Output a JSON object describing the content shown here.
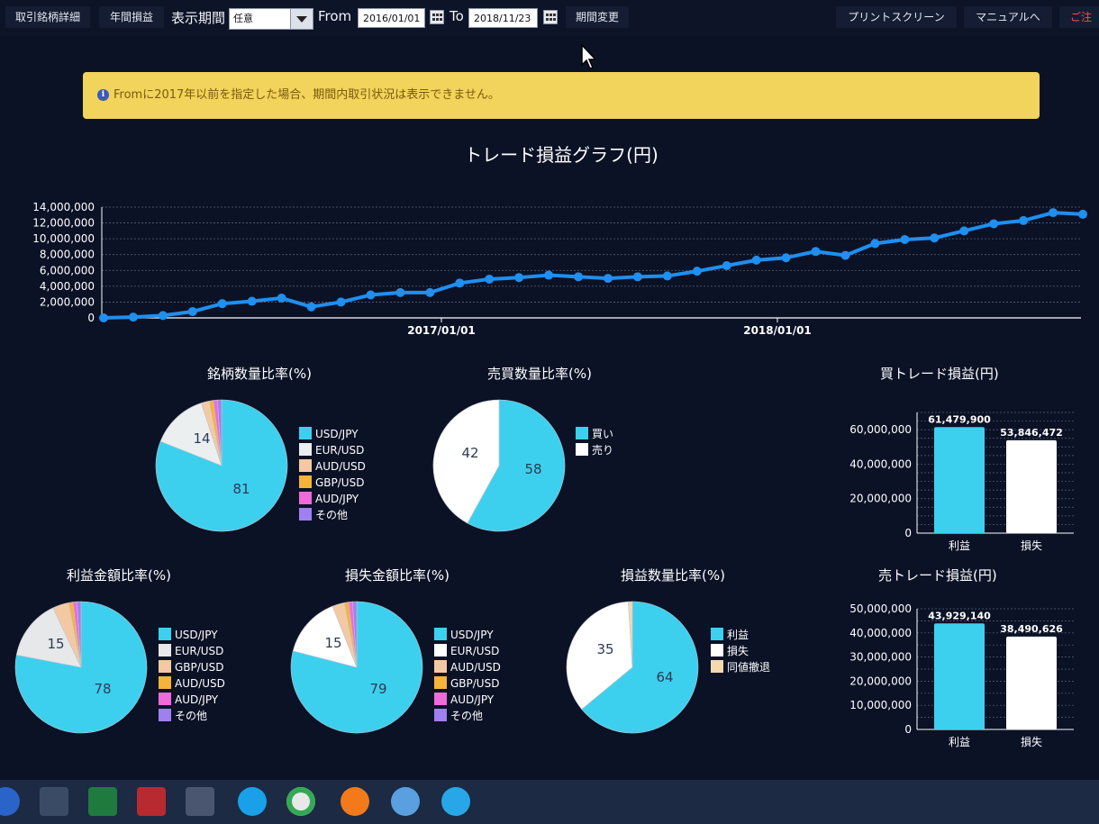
{
  "toolbar": {
    "btn_detail": "取引銘柄詳細",
    "btn_yearly": "年間損益",
    "period_label": "表示期間",
    "period_value": "任意",
    "from_label": "From",
    "from_value": "2016/01/01",
    "to_label": "To",
    "to_value": "2018/11/23",
    "btn_change": "期間変更",
    "btn_print": "プリントスクリーン",
    "btn_manual": "マニュアルへ",
    "btn_extra": "ご注"
  },
  "banner": {
    "text": "Fromに2017年以前を指定した場合、期間内取引状況は表示できません。"
  },
  "colors": {
    "accent": "#1f8ff0",
    "cyan": "#3dd0ee",
    "white": "#ffffff",
    "banner": "#f2d35b"
  },
  "chart_data": [
    {
      "type": "line",
      "title": "トレード損益グラフ(円)",
      "x_ticks": [
        "2017/01/01",
        "2018/01/01"
      ],
      "y_ticks": [
        "0",
        "2,000,000",
        "4,000,000",
        "6,000,000",
        "8,000,000",
        "10,000,000",
        "12,000,000",
        "14,000,000"
      ],
      "ylim": [
        0,
        14000000
      ],
      "values": [
        0,
        100000,
        300000,
        800000,
        1800000,
        2100000,
        2500000,
        1400000,
        2000000,
        2900000,
        3200000,
        3200000,
        4400000,
        4900000,
        5100000,
        5400000,
        5200000,
        5000000,
        5200000,
        5300000,
        5900000,
        6600000,
        7300000,
        7600000,
        8400000,
        7900000,
        9400000,
        9900000,
        10100000,
        11000000,
        11900000,
        12300000,
        13300000,
        13100000
      ]
    },
    {
      "type": "pie",
      "title": "銘柄数量比率(%)",
      "slices": [
        {
          "label": "USD/JPY",
          "value": 81,
          "color": "#3dd0ee"
        },
        {
          "label": "EUR/USD",
          "value": 14,
          "color": "#eceff0"
        },
        {
          "label": "AUD/USD",
          "value": 2,
          "color": "#f3c9a4"
        },
        {
          "label": "GBP/USD",
          "value": 1,
          "color": "#f5b33a"
        },
        {
          "label": "AUD/JPY",
          "value": 1,
          "color": "#f06ad9"
        },
        {
          "label": "その他",
          "value": 1,
          "color": "#a07ff0"
        }
      ]
    },
    {
      "type": "pie",
      "title": "売買数量比率(%)",
      "slices": [
        {
          "label": "買い",
          "value": 58,
          "color": "#3dd0ee"
        },
        {
          "label": "売り",
          "value": 42,
          "color": "#ffffff"
        }
      ]
    },
    {
      "type": "bar",
      "title": "買トレード損益(円)",
      "categories": [
        "利益",
        "損失"
      ],
      "values": [
        61479900,
        53846472
      ],
      "data_labels": [
        "61,479,900",
        "53,846,472"
      ],
      "y_ticks": [
        "0",
        "20,000,000",
        "40,000,000",
        "60,000,000"
      ],
      "ylim": [
        0,
        70000000
      ]
    },
    {
      "type": "pie",
      "title": "利益金額比率(%)",
      "slices": [
        {
          "label": "USD/JPY",
          "value": 78,
          "color": "#3dd0ee"
        },
        {
          "label": "EUR/USD",
          "value": 15,
          "color": "#e6e8ea"
        },
        {
          "label": "GBP/USD",
          "value": 4,
          "color": "#f3c9a4"
        },
        {
          "label": "AUD/USD",
          "value": 1,
          "color": "#f5b33a"
        },
        {
          "label": "AUD/JPY",
          "value": 1,
          "color": "#f06ad9"
        },
        {
          "label": "その他",
          "value": 1,
          "color": "#a07ff0"
        }
      ]
    },
    {
      "type": "pie",
      "title": "損失金額比率(%)",
      "slices": [
        {
          "label": "USD/JPY",
          "value": 79,
          "color": "#3dd0ee"
        },
        {
          "label": "EUR/USD",
          "value": 15,
          "color": "#ffffff"
        },
        {
          "label": "AUD/USD",
          "value": 3,
          "color": "#f3c9a4"
        },
        {
          "label": "GBP/USD",
          "value": 1,
          "color": "#f5b33a"
        },
        {
          "label": "AUD/JPY",
          "value": 1,
          "color": "#f06ad9"
        },
        {
          "label": "その他",
          "value": 1,
          "color": "#a07ff0"
        }
      ]
    },
    {
      "type": "pie",
      "title": "損益数量比率(%)",
      "slices": [
        {
          "label": "利益",
          "value": 64,
          "color": "#3dd0ee"
        },
        {
          "label": "損失",
          "value": 35,
          "color": "#ffffff"
        },
        {
          "label": "同値撤退",
          "value": 1,
          "color": "#f3d9b0"
        }
      ]
    },
    {
      "type": "bar",
      "title": "売トレード損益(円)",
      "categories": [
        "利益",
        "損失"
      ],
      "values": [
        43929140,
        38490626
      ],
      "data_labels": [
        "43,929,140",
        "38,490,626"
      ],
      "y_ticks": [
        "0",
        "10,000,000",
        "20,000,000",
        "30,000,000",
        "40,000,000",
        "50,000,000"
      ],
      "ylim": [
        0,
        50000000
      ]
    }
  ]
}
